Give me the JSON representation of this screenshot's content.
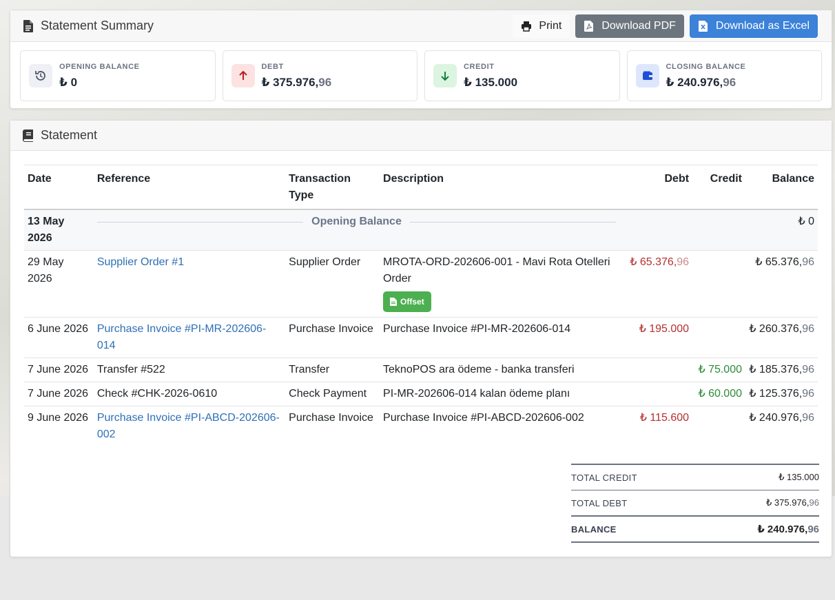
{
  "summary": {
    "title": "Statement Summary",
    "buttons": {
      "print": "Print",
      "pdf": "Download PDF",
      "excel": "Download as Excel"
    },
    "stats": [
      {
        "label": "OPENING BALANCE",
        "currency": "₺",
        "whole": "0",
        "dec": "",
        "icon": "history-icon",
        "icon_bg": "#eef0f6",
        "icon_color": "#4b5563"
      },
      {
        "label": "DEBT",
        "currency": "₺",
        "whole": "375.976,",
        "dec": "96",
        "icon": "arrow-up-icon",
        "icon_bg": "#fde2e2",
        "icon_color": "#b91c1c"
      },
      {
        "label": "CREDIT",
        "currency": "₺",
        "whole": "135.000",
        "dec": "",
        "icon": "arrow-down-icon",
        "icon_bg": "#dcf5e0",
        "icon_color": "#15803d"
      },
      {
        "label": "CLOSING BALANCE",
        "currency": "₺",
        "whole": "240.976,",
        "dec": "96",
        "icon": "wallet-icon",
        "icon_bg": "#dde6fb",
        "icon_color": "#1d4ed8"
      }
    ]
  },
  "statement": {
    "title": "Statement",
    "columns": [
      "Date",
      "Reference",
      "Transaction Type",
      "Description",
      "Debt",
      "Credit",
      "Balance"
    ],
    "opening": {
      "date": "13 May 2026",
      "label": "Opening Balance",
      "balance": "₺ 0"
    },
    "rows": [
      {
        "date": "29 May 2026",
        "reference": "Supplier Order #1",
        "ref_link": true,
        "type": "Supplier Order",
        "description": "MROTA-ORD-202606-001 - Mavi Rota Otelleri Order",
        "badge": "Offset",
        "debt_whole": "₺ 65.376,",
        "debt_dec": "96",
        "credit": "",
        "bal_whole": "₺ 65.376,",
        "bal_dec": "96"
      },
      {
        "date": "6 June 2026",
        "reference": "Purchase Invoice #PI-MR-202606-014",
        "ref_link": true,
        "type": "Purchase Invoice",
        "description": "Purchase Invoice #PI-MR-202606-014",
        "badge": "",
        "debt_whole": "₺ 195.000",
        "debt_dec": "",
        "credit": "",
        "bal_whole": "₺ 260.376,",
        "bal_dec": "96"
      },
      {
        "date": "7 June 2026",
        "reference": "Transfer #522",
        "ref_link": false,
        "type": "Transfer",
        "description": "TeknoPOS ara ödeme - banka transferi",
        "badge": "",
        "debt_whole": "",
        "debt_dec": "",
        "credit": "₺ 75.000",
        "bal_whole": "₺ 185.376,",
        "bal_dec": "96"
      },
      {
        "date": "7 June 2026",
        "reference": "Check #CHK-2026-0610",
        "ref_link": false,
        "type": "Check Payment",
        "description": "PI-MR-202606-014 kalan ödeme planı",
        "badge": "",
        "debt_whole": "",
        "debt_dec": "",
        "credit": "₺ 60.000",
        "bal_whole": "₺ 125.376,",
        "bal_dec": "96"
      },
      {
        "date": "9 June 2026",
        "reference": "Purchase Invoice #PI-ABCD-202606-002",
        "ref_link": true,
        "type": "Purchase Invoice",
        "description": "Purchase Invoice #PI-ABCD-202606-002",
        "badge": "",
        "debt_whole": "₺ 115.600",
        "debt_dec": "",
        "credit": "",
        "bal_whole": "₺ 240.976,",
        "bal_dec": "96"
      }
    ],
    "totals": [
      {
        "label": "TOTAL CREDIT",
        "whole": "₺ 135.000",
        "dec": ""
      },
      {
        "label": "TOTAL DEBT",
        "whole": "₺ 375.976,",
        "dec": "96"
      },
      {
        "label": "BALANCE",
        "whole": "₺ 240.976,",
        "dec": "96"
      }
    ]
  },
  "colors": {
    "link": "#2f6fb5",
    "debt": "#b53030",
    "credit": "#2e8b3a",
    "excel": "#3b82d8",
    "pdf": "#6c757d",
    "badge": "#4caf50"
  }
}
